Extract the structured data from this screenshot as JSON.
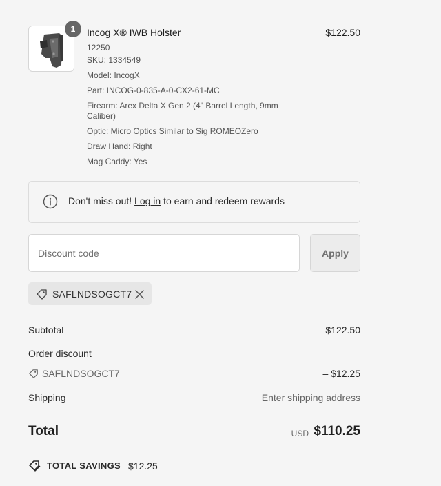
{
  "product": {
    "name": "Incog X® IWB Holster",
    "price": "$122.50",
    "quantity": "1",
    "properties": {
      "id": "12250",
      "sku": "SKU: 1334549",
      "model": "Model: IncogX",
      "part": "Part: INCOG-0-835-A-0-CX2-61-MC",
      "firearm": "Firearm: Arex Delta X Gen 2 (4\" Barrel Length, 9mm Caliber)",
      "optic": "Optic: Micro Optics Similar to Sig ROMEOZero",
      "draw_hand": "Draw Hand: Right",
      "mag_caddy": "Mag Caddy: Yes"
    }
  },
  "rewards": {
    "prefix": "Don't miss out! ",
    "link": "Log in",
    "suffix": " to earn and redeem rewards"
  },
  "discount": {
    "placeholder": "Discount code",
    "apply_label": "Apply",
    "applied_code": "SAFLNDSOGCT7"
  },
  "summary": {
    "subtotal_label": "Subtotal",
    "subtotal_value": "$122.50",
    "order_discount_label": "Order discount",
    "discount_code": "SAFLNDSOGCT7",
    "discount_value": "– $12.25",
    "shipping_label": "Shipping",
    "shipping_value": "Enter shipping address",
    "total_label": "Total",
    "currency": "USD",
    "total_value": "$110.25",
    "savings_label": "TOTAL SAVINGS",
    "savings_value": "$12.25"
  },
  "icons": {
    "info": "info-circle-icon",
    "tag": "price-tag-icon",
    "remove": "close-icon",
    "savings": "savings-tag-icon"
  }
}
